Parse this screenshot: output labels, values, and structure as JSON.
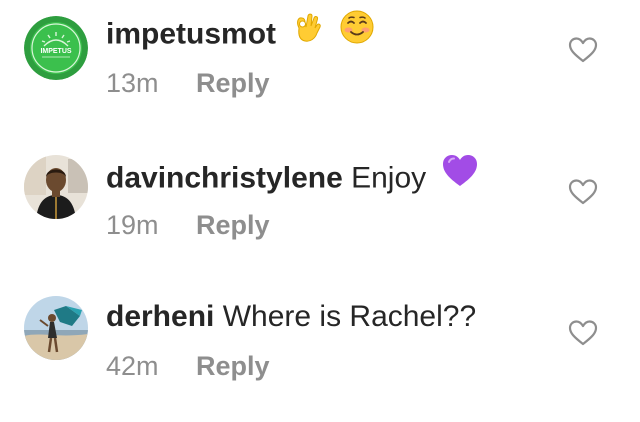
{
  "comments": [
    {
      "username": "impetusmot",
      "text": "",
      "emojis": [
        "ok-hand-emoji",
        "smiling-blush-emoji"
      ],
      "time": "13m",
      "reply_label": "Reply",
      "avatar_label": "IMPETUS"
    },
    {
      "username": "davinchristylene",
      "text": "Enjoy",
      "emojis": [
        "purple-heart-emoji"
      ],
      "time": "19m",
      "reply_label": "Reply"
    },
    {
      "username": "derheni",
      "text": "Where is Rachel??",
      "emojis": [],
      "time": "42m",
      "reply_label": "Reply"
    }
  ],
  "colors": {
    "text": "#262626",
    "meta": "#8e8e8e",
    "impetus_green": "#1fa34a",
    "purple_heart": "#a24ce6",
    "emoji_yellow": "#ffcc33"
  },
  "icons": {
    "like": "heart-outline-icon"
  }
}
